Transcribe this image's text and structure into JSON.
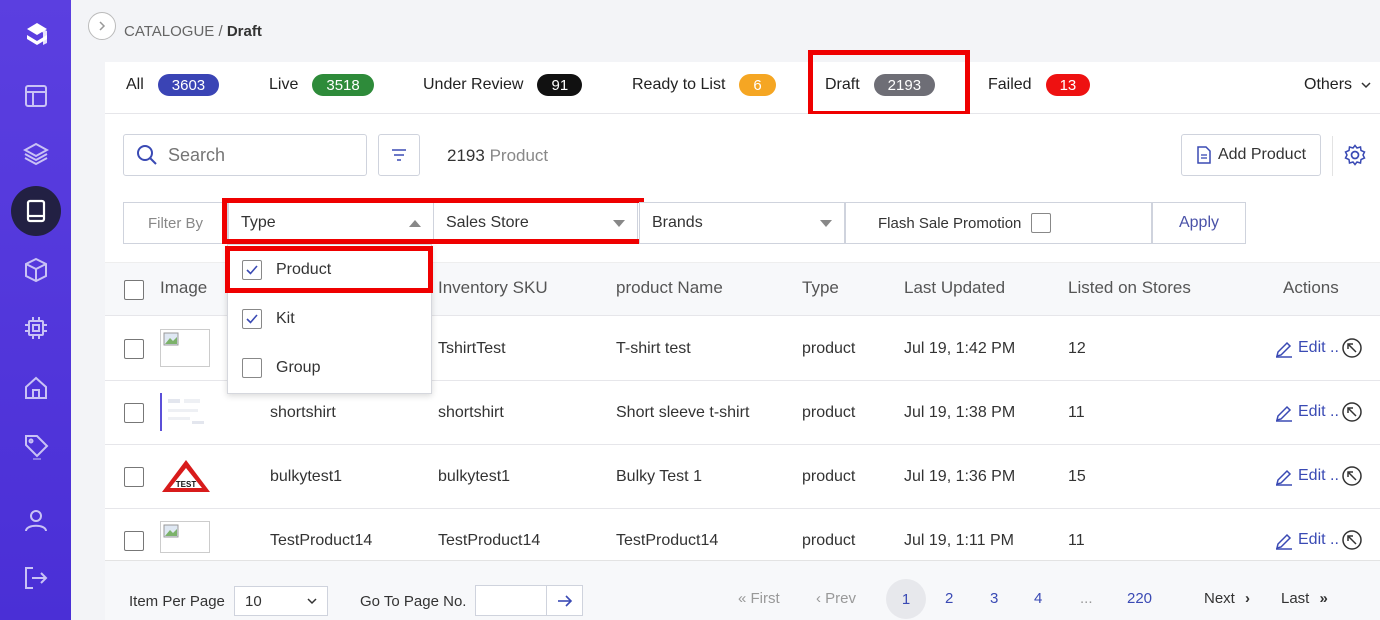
{
  "breadcrumb": {
    "root": "CATALOGUE",
    "separator": " / ",
    "current": "Draft"
  },
  "status_tabs": [
    {
      "label": "All",
      "count": "3603",
      "color": "#3a44b5"
    },
    {
      "label": "Live",
      "count": "3518",
      "color": "#2e8b3a"
    },
    {
      "label": "Under Review",
      "count": "91",
      "color": "#111111"
    },
    {
      "label": "Ready to List",
      "count": "6",
      "color": "#f5a623"
    },
    {
      "label": "Draft",
      "count": "2193",
      "color": "#6e6e76"
    },
    {
      "label": "Failed",
      "count": "13",
      "color": "#ee1111"
    }
  ],
  "others_label": "Others",
  "search": {
    "placeholder": "Search"
  },
  "product_count": {
    "number": "2193",
    "label": "Product"
  },
  "add_product_label": "Add Product",
  "filters": {
    "label": "Filter By",
    "type": "Type",
    "sales_store": "Sales Store",
    "brands": "Brands",
    "flash_sale": "Flash Sale Promotion",
    "apply": "Apply"
  },
  "type_options": [
    {
      "label": "Product",
      "checked": true
    },
    {
      "label": "Kit",
      "checked": true
    },
    {
      "label": "Group",
      "checked": false
    }
  ],
  "table": {
    "headers": [
      "Image",
      "Inventory SKU",
      "product Name",
      "Type",
      "Last Updated",
      "Listed on Stores",
      "Actions"
    ],
    "rows": [
      {
        "sku_name": "",
        "sku": "TshirtTest",
        "name": "T-shirt test",
        "type": "product",
        "updated": "Jul 19, 1:42 PM",
        "stores": "12",
        "action": "Edit .."
      },
      {
        "sku_name": "shortshirt",
        "sku": "shortshirt",
        "name": "Short sleeve t-shirt",
        "type": "product",
        "updated": "Jul 19, 1:38 PM",
        "stores": "11",
        "action": "Edit .."
      },
      {
        "sku_name": "bulkytest1",
        "sku": "bulkytest1",
        "name": "Bulky Test 1",
        "type": "product",
        "updated": "Jul 19, 1:36 PM",
        "stores": "15",
        "action": "Edit .."
      },
      {
        "sku_name": "TestProduct14",
        "sku": "TestProduct14",
        "name": "TestProduct14",
        "type": "product",
        "updated": "Jul 19, 1:11 PM",
        "stores": "11",
        "action": "Edit .."
      }
    ]
  },
  "test_sign_text": "TEST",
  "footer": {
    "item_per_page_label": "Item Per Page",
    "item_per_page_value": "10",
    "go_to_page_label": "Go To Page No.",
    "first": "First",
    "prev": "Prev",
    "pages": [
      "1",
      "2",
      "3",
      "4",
      "...",
      "220"
    ],
    "next": "Next",
    "last": "Last"
  },
  "sidebar_icons": [
    "logo-icon",
    "dashboard-icon",
    "layers-icon",
    "catalogue-icon",
    "box-icon",
    "chip-icon",
    "home-icon",
    "tag-icon",
    "user-icon",
    "logout-icon"
  ],
  "accent_color": "#4a2fd6",
  "highlight_color": "#ef0000"
}
